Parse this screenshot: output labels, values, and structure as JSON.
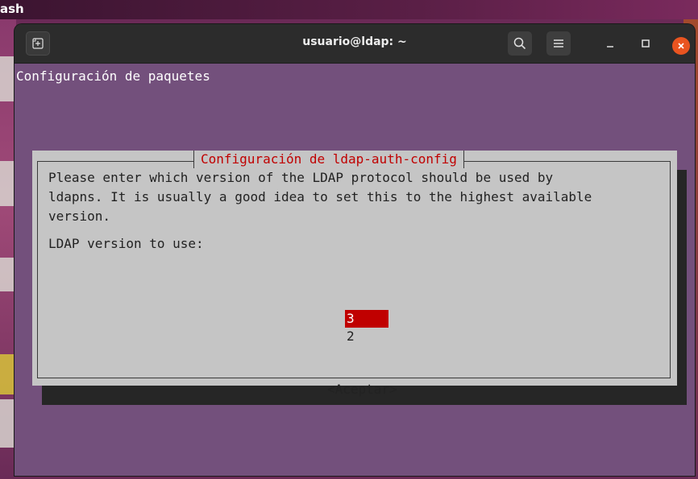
{
  "desktop": {
    "topbar_text": "ash"
  },
  "window": {
    "title": "usuario@ldap: ~",
    "buttons": {
      "new_tab_icon": "new-tab-icon",
      "search_icon": "search-icon",
      "menu_icon": "hamburger-menu-icon",
      "minimize_icon": "minimize-icon",
      "maximize_icon": "maximize-icon",
      "close_icon": "close-icon"
    }
  },
  "terminal": {
    "header": "Configuración de paquetes",
    "dialog": {
      "title": "Configuración de ldap-auth-config",
      "text": "Please enter which version of the LDAP protocol should be used by\nldapns. It is usually a good idea to set this to the highest available\nversion.",
      "label": "LDAP version to use:",
      "options": [
        "3",
        "2"
      ],
      "selected": "3",
      "accept_button": "<Aceptar>"
    }
  },
  "colors": {
    "terminal_bg": "#73507c",
    "dialog_bg": "#c5c5c5",
    "accent_red": "#c00000",
    "close_button": "#e95420"
  }
}
